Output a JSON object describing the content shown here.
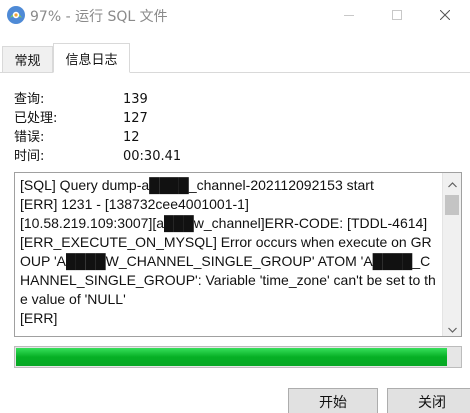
{
  "window": {
    "title": "97% - 运行 SQL 文件"
  },
  "tabs": [
    {
      "label": "常规"
    },
    {
      "label": "信息日志"
    }
  ],
  "stats": [
    {
      "label": "查询:",
      "value": "139"
    },
    {
      "label": "已处理:",
      "value": "127"
    },
    {
      "label": "错误:",
      "value": "12"
    },
    {
      "label": "时间:",
      "value": "00:30.41"
    }
  ],
  "log": {
    "text": "[SQL] Query dump-a████_channel-202112092153 start\n[ERR] 1231 - [138732cee4001001-1]\n[10.58.219.109:3007][a███w_channel]ERR-CODE: [TDDL-4614][ERR_EXECUTE_ON_MYSQL] Error occurs when execute on GROUP 'A████W_CHANNEL_SINGLE_GROUP' ATOM 'A████_CHANNEL_SINGLE_GROUP': Variable 'time_zone' can't be set to the value of 'NULL'\n[ERR]"
  },
  "progress": {
    "percent": 97
  },
  "buttons": {
    "start": "开始",
    "close": "关闭"
  },
  "colors": {
    "progress_green": "#06b025",
    "title_gray": "#8a8a8a"
  },
  "icons": {
    "app": "navicat-app-icon",
    "minimize": "minimize-icon",
    "maximize": "maximize-icon",
    "close": "close-icon"
  }
}
